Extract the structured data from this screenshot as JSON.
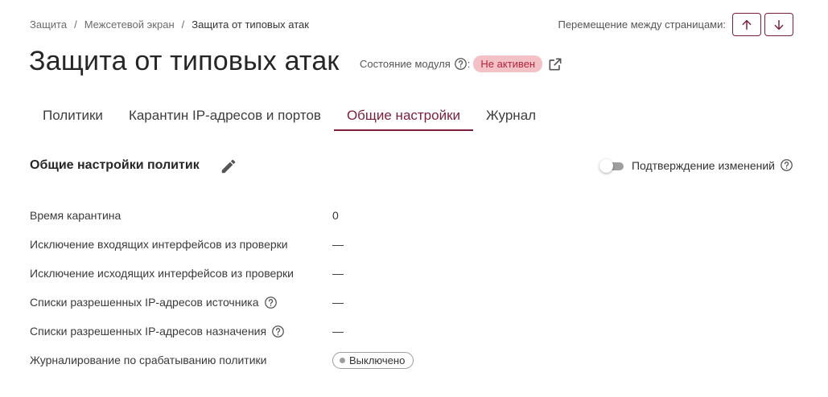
{
  "breadcrumb": {
    "items": [
      "Защита",
      "Межсетевой экран"
    ],
    "separator": "/",
    "current": "Защита от типовых атак"
  },
  "pager": {
    "label": "Перемещение между страницами:",
    "up_icon": "arrow-up-icon",
    "down_icon": "arrow-down-icon"
  },
  "page_title": "Защита от типовых атак",
  "module_state": {
    "label": "Состояние модуля",
    "colon": ":",
    "status": "Не активен",
    "status_color": "#b3263a"
  },
  "tabs": [
    {
      "label": "Политики",
      "active": false
    },
    {
      "label": "Карантин IP-адресов и портов",
      "active": false
    },
    {
      "label": "Общие настройки",
      "active": true
    },
    {
      "label": "Журнал",
      "active": false
    }
  ],
  "section": {
    "title": "Общие настройки политик",
    "edit_icon": "pencil-icon"
  },
  "confirm_changes": {
    "label": "Подтверждение изменений",
    "enabled": false
  },
  "settings": [
    {
      "label": "Время карантина",
      "value": "0",
      "help": false
    },
    {
      "label": "Исключение входящих интерфейсов из проверки",
      "value": "—",
      "help": false
    },
    {
      "label": "Исключение исходящих интерфейсов из проверки",
      "value": "—",
      "help": false
    },
    {
      "label": "Списки разрешенных IP-адресов источника",
      "value": "—",
      "help": true
    },
    {
      "label": "Списки разрешенных IP-адресов назначения",
      "value": "—",
      "help": true
    },
    {
      "label": "Журналирование по срабатыванию политики",
      "value": "Выключено",
      "help": false,
      "pill": true
    }
  ],
  "colors": {
    "accent": "#7a1f3a",
    "inactive_badge_bg": "#f3c1c6"
  }
}
